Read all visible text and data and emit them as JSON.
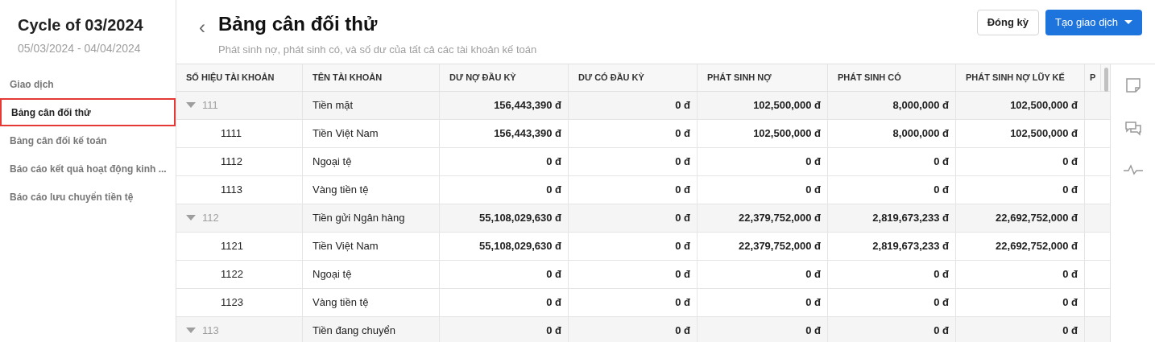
{
  "sidebar": {
    "title": "Cycle of 03/2024",
    "subtitle": "05/03/2024 - 04/04/2024",
    "items": [
      {
        "label": "Giao dịch",
        "selected": false
      },
      {
        "label": "Bảng cân đối thử",
        "selected": true
      },
      {
        "label": "Bảng cân đối kế toán",
        "selected": false
      },
      {
        "label": "Báo cáo kết quả hoạt động kinh ...",
        "selected": false
      },
      {
        "label": "Báo cáo lưu chuyển tiền tệ",
        "selected": false
      }
    ]
  },
  "header": {
    "back": "‹",
    "title": "Bảng cân đối thử",
    "subtitle": "Phát sinh nợ, phát sinh có, và số dư của tất cả các tài khoản kế toán",
    "buttons": [
      {
        "label": "Đóng kỳ",
        "kind": "secondary"
      },
      {
        "label": "Tạo giao dịch",
        "kind": "primary"
      }
    ]
  },
  "table": {
    "columns": [
      "SỐ HIỆU TÀI KHOẢN",
      "TÊN TÀI KHOẢN",
      "DƯ NỢ ĐẦU KỲ",
      "DƯ CÓ ĐẦU KỲ",
      "PHÁT SINH NỢ",
      "PHÁT SINH CÓ",
      "PHÁT SINH NỢ LŨY KẾ",
      "P"
    ],
    "rows": [
      {
        "code": "111",
        "name": "Tiền mặt",
        "values": [
          "156,443,390 đ",
          "0 đ",
          "102,500,000 đ",
          "8,000,000 đ",
          "102,500,000 đ"
        ],
        "expanded": true,
        "children": [
          {
            "code": "1111",
            "name": "Tiền Việt Nam",
            "values": [
              "156,443,390 đ",
              "0 đ",
              "102,500,000 đ",
              "8,000,000 đ",
              "102,500,000 đ"
            ]
          },
          {
            "code": "1112",
            "name": "Ngoại tệ",
            "values": [
              "0 đ",
              "0 đ",
              "0 đ",
              "0 đ",
              "0 đ"
            ]
          },
          {
            "code": "1113",
            "name": "Vàng tiền tệ",
            "values": [
              "0 đ",
              "0 đ",
              "0 đ",
              "0 đ",
              "0 đ"
            ]
          }
        ]
      },
      {
        "code": "112",
        "name": "Tiền gửi Ngân hàng",
        "values": [
          "55,108,029,630 đ",
          "0 đ",
          "22,379,752,000 đ",
          "2,819,673,233 đ",
          "22,692,752,000 đ"
        ],
        "expanded": true,
        "children": [
          {
            "code": "1121",
            "name": "Tiền Việt Nam",
            "values": [
              "55,108,029,630 đ",
              "0 đ",
              "22,379,752,000 đ",
              "2,819,673,233 đ",
              "22,692,752,000 đ"
            ]
          },
          {
            "code": "1122",
            "name": "Ngoại tệ",
            "values": [
              "0 đ",
              "0 đ",
              "0 đ",
              "0 đ",
              "0 đ"
            ]
          },
          {
            "code": "1123",
            "name": "Vàng tiền tệ",
            "values": [
              "0 đ",
              "0 đ",
              "0 đ",
              "0 đ",
              "0 đ"
            ]
          }
        ]
      },
      {
        "code": "113",
        "name": "Tiền đang chuyển",
        "values": [
          "0 đ",
          "0 đ",
          "0 đ",
          "0 đ",
          "0 đ"
        ],
        "expanded": true
      }
    ]
  }
}
